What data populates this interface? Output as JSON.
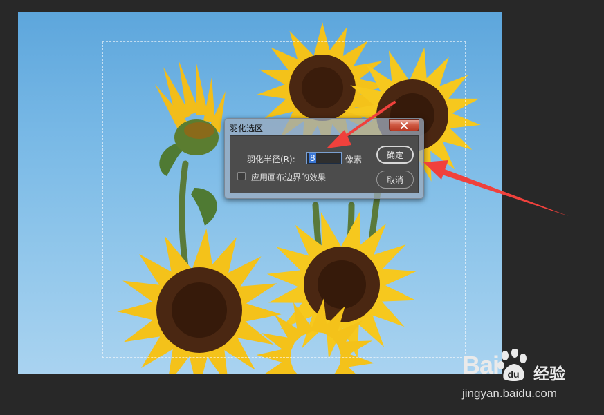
{
  "dialog": {
    "title": "羽化选区",
    "radius_label": "羽化半径(R):",
    "radius_value": "8",
    "unit_label": "像素",
    "apply_canvas_bounds_label": "应用画布边界的效果",
    "apply_canvas_bounds_checked": false,
    "ok_label": "确定",
    "cancel_label": "取消"
  },
  "watermark": {
    "brand_prefix": "Bai",
    "brand_suffix": "经验",
    "url": "jingyan.baidu.com"
  },
  "colors": {
    "annotation_arrow": "#f0413c",
    "sky": "#79b9e6",
    "petal": "#f4c21a",
    "flower_center": "#4a2712",
    "dialog_bg": "#4c4c4c",
    "selection_text": "#3a76d4",
    "close_button": "#cf5a43"
  },
  "icons": {
    "close": "close-icon",
    "watermark": "paw-icon"
  }
}
